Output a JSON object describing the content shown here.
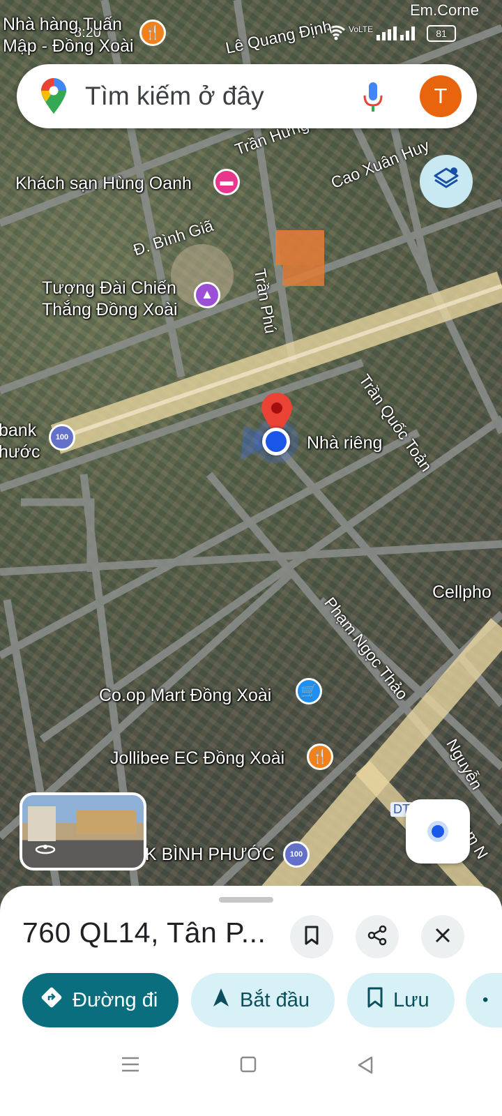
{
  "status": {
    "time": "8:20",
    "carrier": "Em.Corne",
    "lte": "VoLTE",
    "battery": "81"
  },
  "search": {
    "placeholder": "Tìm kiếm ở đây",
    "avatar_letter": "T",
    "icons": [
      "maps-logo-icon",
      "microphone-icon"
    ]
  },
  "map": {
    "pois": [
      {
        "line1": "Nhà hàng Tuấn",
        "line2": "Mập - Đồng Xoài",
        "icon": "restaurant-icon"
      },
      {
        "line1": "Khách sạn Hùng Oanh",
        "icon": "hotel-icon"
      },
      {
        "line1": "Tượng Đài Chiến",
        "line2": "Thắng Đồng Xoài",
        "icon": "monument-icon"
      },
      {
        "line1": "bank",
        "line2": "hước",
        "icon": "bank-icon"
      },
      {
        "line1": "Nhà riêng",
        "icon": "location-pin-icon"
      },
      {
        "line1": "Co.op Mart Đồng Xoài",
        "icon": "shopping-cart-icon"
      },
      {
        "line1": "Jollibee EC Đồng Xoài",
        "icon": "restaurant-icon"
      },
      {
        "line1": "NK BÌNH PHƯỚC",
        "icon": "bank-icon"
      },
      {
        "line1": "Cellpho"
      }
    ],
    "streets": [
      "Lê Quang Định",
      "Trần Hưng",
      "Cao Xuân Huy",
      "Đ. Bình Giã",
      "Trần Phú",
      "Trần Quốc Toản",
      "Phạm Ngọc Thảo",
      "Nguyễn",
      "Phạm N",
      "DT"
    ],
    "accent_blue": "#1a56e8",
    "pin_red": "#ea4335"
  },
  "sheet": {
    "title": "760 QL14, Tân P...",
    "actions": [
      {
        "label": "Đường đi",
        "icon": "directions-icon"
      },
      {
        "label": "Bắt đầu",
        "icon": "navigation-arrow-icon"
      },
      {
        "label": "Lưu",
        "icon": "bookmark-icon"
      }
    ],
    "header_buttons": [
      "bookmark-icon",
      "share-icon",
      "close-icon"
    ],
    "primary_color": "#0b6e7f",
    "secondary_bg": "#d7f1f7"
  },
  "navbar": [
    "menu-icon",
    "home-square-icon",
    "back-triangle-icon"
  ]
}
